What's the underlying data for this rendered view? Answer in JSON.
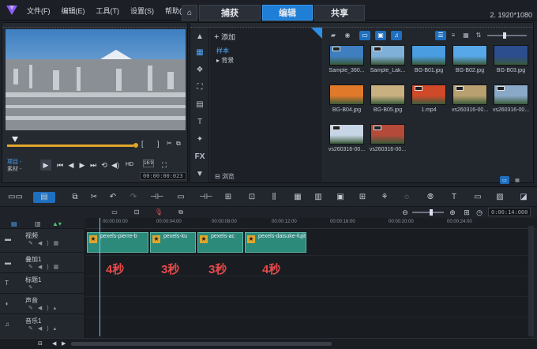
{
  "menu": [
    "文件(F)",
    "编辑(E)",
    "工具(T)",
    "设置(S)",
    "帮助(H)"
  ],
  "tabs": {
    "capture": "捕获",
    "edit": "编辑",
    "share": "共享"
  },
  "resolution": "2. 1920*1080",
  "preview": {
    "mode_project": "项目 -",
    "mode_clip": "素材 -",
    "hd_label": "HD",
    "timecode": "00:00:00:023"
  },
  "library": {
    "add_label": "添加",
    "folders": [
      "样本",
      "背景"
    ],
    "detect_label": "浏览",
    "thumbnails": [
      {
        "caption": "Sample_360...",
        "kind": "video",
        "color": "#3f7fc0"
      },
      {
        "caption": "Sample_Lak...",
        "kind": "video",
        "color": "#7fb0d8"
      },
      {
        "caption": "BG-B01.jpg",
        "kind": "image",
        "color": "#4a9de0"
      },
      {
        "caption": "BG-B02.jpg",
        "kind": "image",
        "color": "#57a8e8"
      },
      {
        "caption": "BG-B03.jpg",
        "kind": "image",
        "color": "#2c4d8e"
      },
      {
        "caption": "BG-B04.jpg",
        "kind": "image",
        "color": "#e07a2a"
      },
      {
        "caption": "BG-B05.jpg",
        "kind": "image",
        "color": "#c8b080"
      },
      {
        "caption": "1.mp4",
        "kind": "video",
        "color": "#d04a2a"
      },
      {
        "caption": "vs260316-00...",
        "kind": "video",
        "color": "#b8a070"
      },
      {
        "caption": "vs260316-00...",
        "kind": "video",
        "color": "#8aa9c8"
      },
      {
        "caption": "vs260316-00...",
        "kind": "video",
        "color": "#c7d5e6"
      },
      {
        "caption": "vs260316-00...",
        "kind": "video",
        "color": "#b44a3a"
      }
    ]
  },
  "timeline": {
    "zoom_timecode": "0:00:14:000",
    "ruler": [
      "00:00:00:00",
      "00:00:04:00",
      "00:00:08:00",
      "00:00:12:00",
      "00:00:16:00",
      "00:00:20:00",
      "00:00:24:00"
    ],
    "tracks": [
      "视频",
      "叠加1",
      "标题1",
      "声音",
      "音乐1"
    ],
    "clips": [
      {
        "title": "pexels-pierre-b"
      },
      {
        "title": "pexels-ku"
      },
      {
        "title": "pexels-ac"
      },
      {
        "title": "pexels-daisuke-fujita"
      }
    ],
    "durations": [
      "4秒",
      "3秒",
      "3秒",
      "4秒"
    ]
  }
}
